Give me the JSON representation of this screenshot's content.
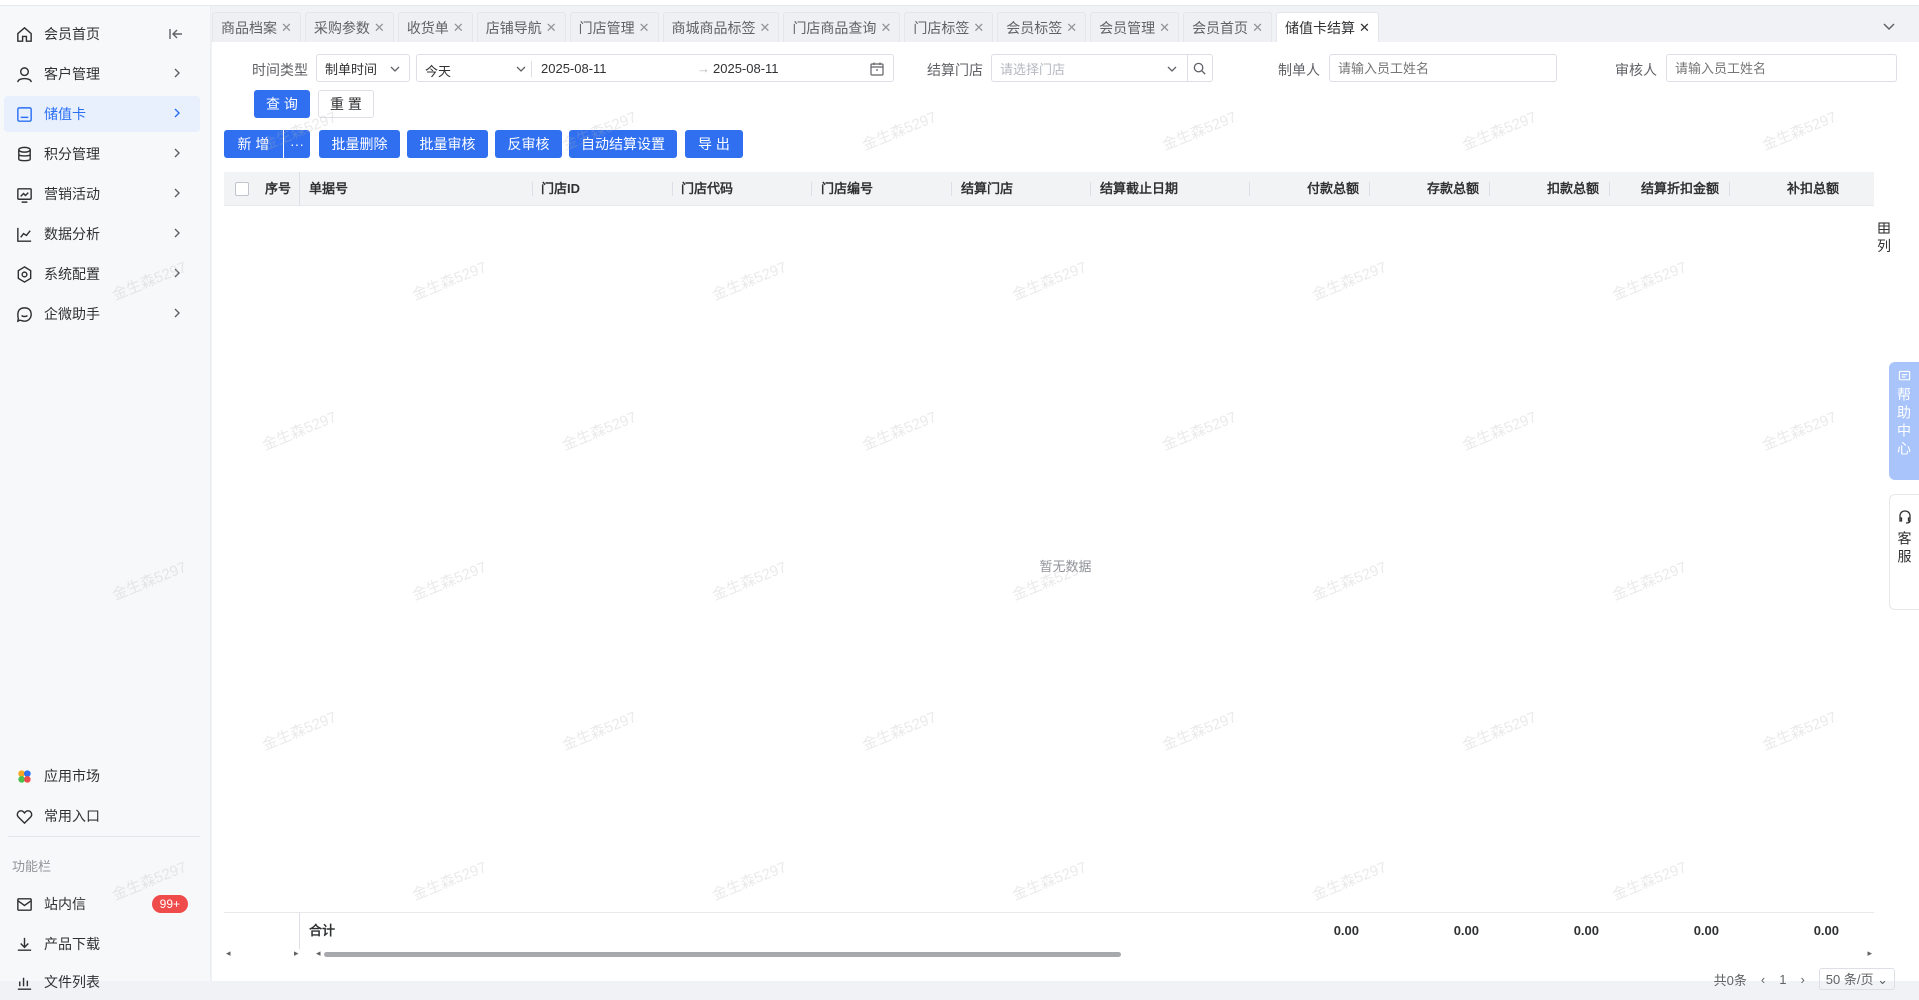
{
  "sidebar": {
    "items": [
      {
        "label": "会员首页",
        "icon": "home-icon"
      },
      {
        "label": "客户管理",
        "icon": "user-icon"
      },
      {
        "label": "储值卡",
        "icon": "card-icon"
      },
      {
        "label": "积分管理",
        "icon": "database-icon"
      },
      {
        "label": "营销活动",
        "icon": "campaign-icon"
      },
      {
        "label": "数据分析",
        "icon": "chart-icon"
      },
      {
        "label": "系统配置",
        "icon": "settings-icon"
      },
      {
        "label": "企微助手",
        "icon": "chat-icon"
      }
    ],
    "bottom": [
      {
        "label": "应用市场",
        "icon": "app-market-icon"
      },
      {
        "label": "常用入口",
        "icon": "heart-icon"
      }
    ],
    "section_label": "功能栏",
    "tools": [
      {
        "label": "站内信",
        "icon": "mail-icon",
        "badge": "99+"
      },
      {
        "label": "产品下载",
        "icon": "download-icon"
      },
      {
        "label": "文件列表",
        "icon": "file-list-icon"
      }
    ]
  },
  "tabs": [
    {
      "label": "商品档案"
    },
    {
      "label": "采购参数"
    },
    {
      "label": "收货单"
    },
    {
      "label": "店铺导航"
    },
    {
      "label": "门店管理"
    },
    {
      "label": "商城商品标签"
    },
    {
      "label": "门店商品查询"
    },
    {
      "label": "门店标签"
    },
    {
      "label": "会员标签"
    },
    {
      "label": "会员管理"
    },
    {
      "label": "会员首页"
    },
    {
      "label": "储值卡结算"
    }
  ],
  "filters": {
    "time_type_label": "时间类型",
    "time_type_value": "制单时间",
    "range_value": "今天",
    "date_start": "2025-08-11",
    "date_sep": "→",
    "date_end": "2025-08-11",
    "store_label": "结算门店",
    "store_placeholder": "请选择门店",
    "creator_label": "制单人",
    "creator_placeholder": "请输入员工姓名",
    "reviewer_label": "审核人",
    "reviewer_placeholder": "请输入员工姓名",
    "query": "查 询",
    "reset": "重 置"
  },
  "toolbar": {
    "add": "新 增",
    "more": "···",
    "batch_delete": "批量删除",
    "batch_review": "批量审核",
    "unreview": "反审核",
    "auto_settle": "自动结算设置",
    "export": "导 出"
  },
  "table": {
    "columns": [
      "序号",
      "单据号",
      "门店ID",
      "门店代码",
      "门店编号",
      "结算门店",
      "结算截止日期",
      "付款总额",
      "存款总额",
      "扣款总额",
      "结算折扣金额",
      "补扣总额"
    ],
    "empty_text": "暂无数据",
    "footer_label": "合计",
    "footer_values": [
      "0.00",
      "0.00",
      "0.00",
      "0.00",
      "0.00"
    ]
  },
  "pager": {
    "total": "共0条",
    "page": "1",
    "page_size": "50 条/页"
  },
  "right_tools": {
    "columns": "列",
    "help": "帮助中心",
    "service": "客服"
  },
  "watermark": "金生森5297",
  "colors": {
    "primary": "#2f6ff0",
    "active_nav_bg": "#e8f0fe",
    "badge": "#f04b4b"
  }
}
